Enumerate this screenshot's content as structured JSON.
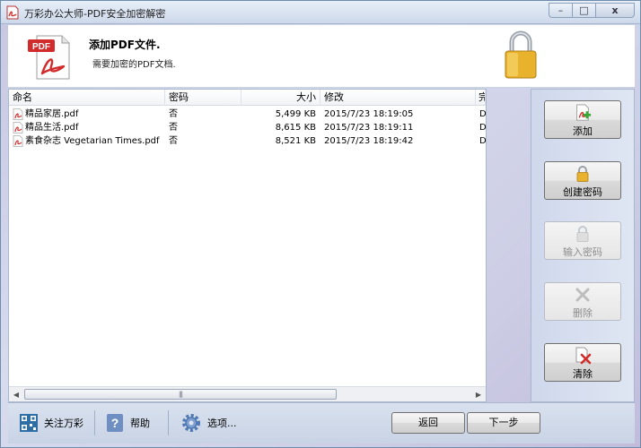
{
  "window": {
    "title": "万彩办公大师-PDF安全加密解密",
    "controls": {
      "minimize": "–",
      "maximize": "□",
      "close": "x"
    }
  },
  "header": {
    "pdf_badge": "PDF",
    "title": "添加PDF文件.",
    "subtitle": "需要加密的PDF文档."
  },
  "table": {
    "columns": [
      {
        "label": "命名"
      },
      {
        "label": "密码"
      },
      {
        "label": "大小"
      },
      {
        "label": "修改"
      },
      {
        "label": "完"
      }
    ],
    "rows": [
      {
        "name": "精品家居.pdf",
        "password": "否",
        "size": "5,499 KB",
        "modified": "2015/7/23 18:19:05",
        "extra": "D"
      },
      {
        "name": "精品生活.pdf",
        "password": "否",
        "size": "8,615 KB",
        "modified": "2015/7/23 18:19:11",
        "extra": "D"
      },
      {
        "name": "素食杂志 Vegetarian Times.pdf",
        "password": "否",
        "size": "8,521 KB",
        "modified": "2015/7/23 18:19:42",
        "extra": "D"
      }
    ],
    "scroll_left": "◀",
    "scroll_right": "▶",
    "scroll_grip": "|||"
  },
  "actions": {
    "add": {
      "label": "添加",
      "icon": "add-file-icon",
      "enabled": true
    },
    "create_password": {
      "label": "创建密码",
      "icon": "lock-icon",
      "enabled": true
    },
    "enter_password": {
      "label": "输入密码",
      "icon": "lock-icon",
      "enabled": false
    },
    "delete": {
      "label": "删除",
      "icon": "x-icon",
      "enabled": false
    },
    "clear": {
      "label": "清除",
      "icon": "clear-icon",
      "enabled": true
    }
  },
  "footer": {
    "follow": "关注万彩",
    "help": "帮助",
    "options": "选项...",
    "back": "返回",
    "next": "下一步"
  },
  "colors": {
    "pdf_red": "#d22b2b",
    "accent_green": "#39a935",
    "lock_gold": "#e8b22c"
  }
}
